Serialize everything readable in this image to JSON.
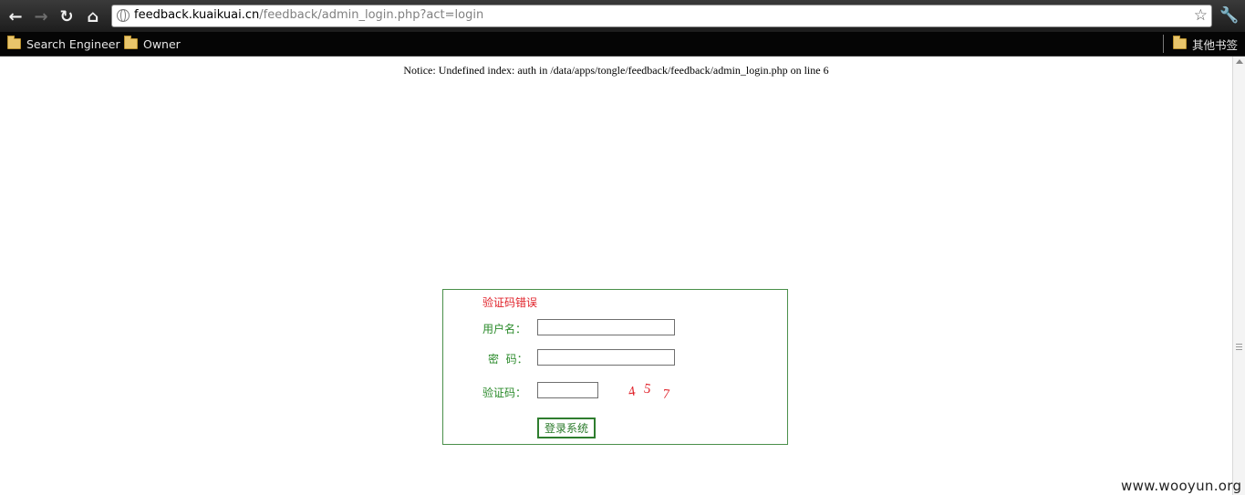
{
  "browser": {
    "url_host": "feedback.kuaikuai.cn",
    "url_path": "/feedback/admin_login.php?act=login",
    "bookmarks": [
      "Search Engineer",
      "Owner"
    ],
    "other_bookmarks": "其他书签"
  },
  "page": {
    "notice": "Notice: Undefined index: auth in /data/apps/tongle/feedback/feedback/admin_login.php on line 6"
  },
  "login": {
    "error": "验证码错误",
    "username_label": "用户名：",
    "password_label": "密  码：",
    "captcha_label": "验证码：",
    "captcha_digits": [
      "4",
      "5",
      "7"
    ],
    "submit_label": "登录系统",
    "colors": {
      "label": "#2a8a2a",
      "error": "#e0222a",
      "captcha": "#e0222a"
    }
  },
  "watermark": "www.wooyun.org"
}
